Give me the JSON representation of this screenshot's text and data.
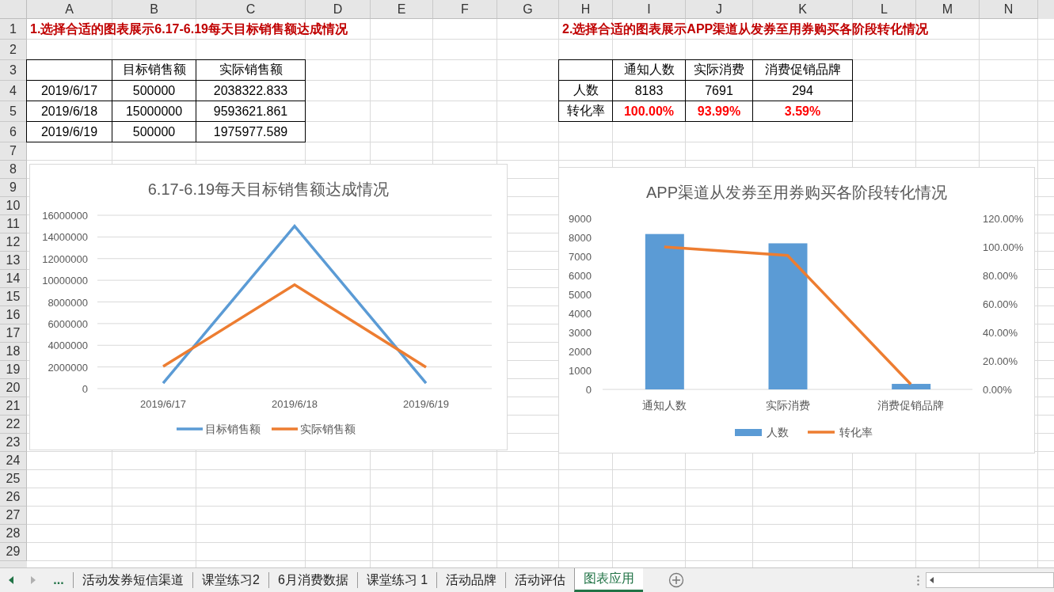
{
  "sheet": {
    "columns": [
      "A",
      "B",
      "C",
      "D",
      "E",
      "F",
      "G",
      "H",
      "I",
      "J",
      "K",
      "L",
      "M",
      "N"
    ],
    "row_numbers": [
      "1",
      "2",
      "3",
      "4",
      "5",
      "6",
      "7",
      "8",
      "9",
      "10",
      "11",
      "12",
      "13",
      "14",
      "15",
      "16",
      "17",
      "18",
      "19",
      "20",
      "21",
      "22",
      "23",
      "24",
      "25",
      "26",
      "27",
      "28",
      "29"
    ],
    "titles": [
      {
        "text": "1.选择合适的图表展示6.17-6.19每天目标销售额达成情况"
      },
      {
        "text": "2.选择合适的图表展示APP渠道从发券至用券购买各阶段转化情况"
      }
    ],
    "tables": [
      {
        "headers": [
          "目标销售额",
          "实际销售额"
        ],
        "rows": [
          {
            "label": "2019/6/17",
            "values": [
              "500000",
              "2038322.833"
            ],
            "emphasized": false
          },
          {
            "label": "2019/6/18",
            "values": [
              "15000000",
              "9593621.861"
            ],
            "emphasized": false
          },
          {
            "label": "2019/6/19",
            "values": [
              "500000",
              "1975977.589"
            ],
            "emphasized": false
          }
        ]
      },
      {
        "headers": [
          "通知人数",
          "实际消费",
          "消费促销品牌"
        ],
        "rows": [
          {
            "label": "人数",
            "values": [
              "8183",
              "7691",
              "294"
            ],
            "emphasized": false
          },
          {
            "label": "转化率",
            "values": [
              "100.00%",
              "93.99%",
              "3.59%"
            ],
            "emphasized": true
          }
        ]
      }
    ],
    "charts": [
      {
        "chart_data": {
          "type": "line",
          "title": "6.17-6.19每天目标销售额达成情况",
          "categories": [
            "2019/6/17",
            "2019/6/18",
            "2019/6/19"
          ],
          "series": [
            {
              "name": "目标销售额",
              "color": "#5b9bd5",
              "values": [
                500000,
                15000000,
                500000
              ]
            },
            {
              "name": "实际销售额",
              "color": "#ed7d31",
              "values": [
                2040000,
                9590000,
                1980000
              ]
            }
          ],
          "grid": true,
          "legend": true,
          "ylim": [
            0,
            16000000
          ],
          "yticks": [
            0,
            2000000,
            4000000,
            6000000,
            8000000,
            10000000,
            12000000,
            14000000,
            16000000
          ]
        }
      },
      {
        "chart_data": {
          "type": "bar",
          "title": "APP渠道从发券至用券购买各阶段转化情况",
          "categories": [
            "通知人数",
            "实际消费",
            "消费促销品牌"
          ],
          "series": [
            {
              "name": "人数",
              "color": "#5b9bd5",
              "type": "bar",
              "values": [
                8180,
                7690,
                290
              ]
            },
            {
              "name": "转化率",
              "color": "#ed7d31",
              "type": "line",
              "axis": "y2",
              "values": [
                1,
                0.94,
                0.036
              ]
            }
          ],
          "grid": false,
          "legend": true,
          "ylim": [
            0,
            9000
          ],
          "y2lim": [
            0,
            1.2
          ],
          "yticks": [
            0,
            1000,
            2000,
            3000,
            4000,
            5000,
            6000,
            7000,
            8000,
            9000
          ],
          "y2ticks": [
            {
              "value": 0,
              "label": "0.00%"
            },
            {
              "value": 0.2,
              "label": "20.00%"
            },
            {
              "value": 0.4,
              "label": "40.00%"
            },
            {
              "value": 0.6,
              "label": "60.00%"
            },
            {
              "value": 0.8,
              "label": "80.00%"
            },
            {
              "value": 1,
              "label": "100.00%"
            },
            {
              "value": 1.2,
              "label": "120.00%"
            }
          ]
        }
      }
    ]
  },
  "sheet_tabs": {
    "overflow": "...",
    "tabs": [
      {
        "label": "活动发券短信渠道",
        "selected": false
      },
      {
        "label": "课堂练习2",
        "selected": false
      },
      {
        "label": "6月消费数据",
        "selected": false
      },
      {
        "label": "课堂练习 1",
        "selected": false
      },
      {
        "label": "活动品牌",
        "selected": false
      },
      {
        "label": "活动评估",
        "selected": false
      },
      {
        "label": "图表应用",
        "selected": true
      }
    ]
  }
}
